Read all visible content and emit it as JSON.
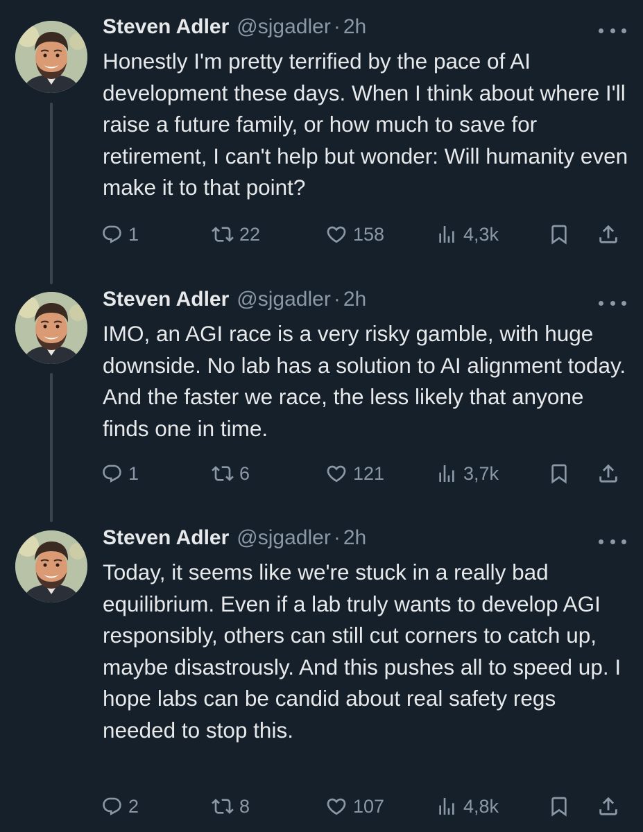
{
  "tweets": [
    {
      "name": "Steven Adler",
      "handle": "@sjgadler",
      "separator": "·",
      "time": "2h",
      "text": "Honestly I'm pretty terrified by the pace of AI development these days. When I think about where I'll raise a future family, or how much to save for retirement, I can't help but wonder: Will humanity even make it to that point?",
      "replies": "1",
      "retweets": "22",
      "likes": "158",
      "views": "4,3k"
    },
    {
      "name": "Steven Adler",
      "handle": "@sjgadler",
      "separator": "·",
      "time": "2h",
      "text": "IMO, an AGI race is a very risky gamble, with huge downside. No lab has a solution to AI alignment today. And the faster we race, the less likely that anyone finds one in time.",
      "replies": "1",
      "retweets": "6",
      "likes": "121",
      "views": "3,7k"
    },
    {
      "name": "Steven Adler",
      "handle": "@sjgadler",
      "separator": "·",
      "time": "2h",
      "text": "Today, it seems like we're stuck in a really bad equilibrium. Even if a lab truly wants to develop AGI responsibly, others can still cut corners to catch up, maybe disastrously. And this pushes all to speed up. I hope labs can be candid about real safety regs needed to stop this.",
      "replies": "2",
      "retweets": "8",
      "likes": "107",
      "views": "4,8k"
    }
  ],
  "icons": {
    "reply": "reply-icon",
    "retweet": "retweet-icon",
    "like": "like-icon",
    "views": "views-icon",
    "bookmark": "bookmark-icon",
    "share": "share-icon",
    "more": "more-icon"
  },
  "colors": {
    "background": "#15202b",
    "text": "#e7e9ea",
    "secondary": "#8b98a5",
    "thread_line": "#38444d"
  }
}
